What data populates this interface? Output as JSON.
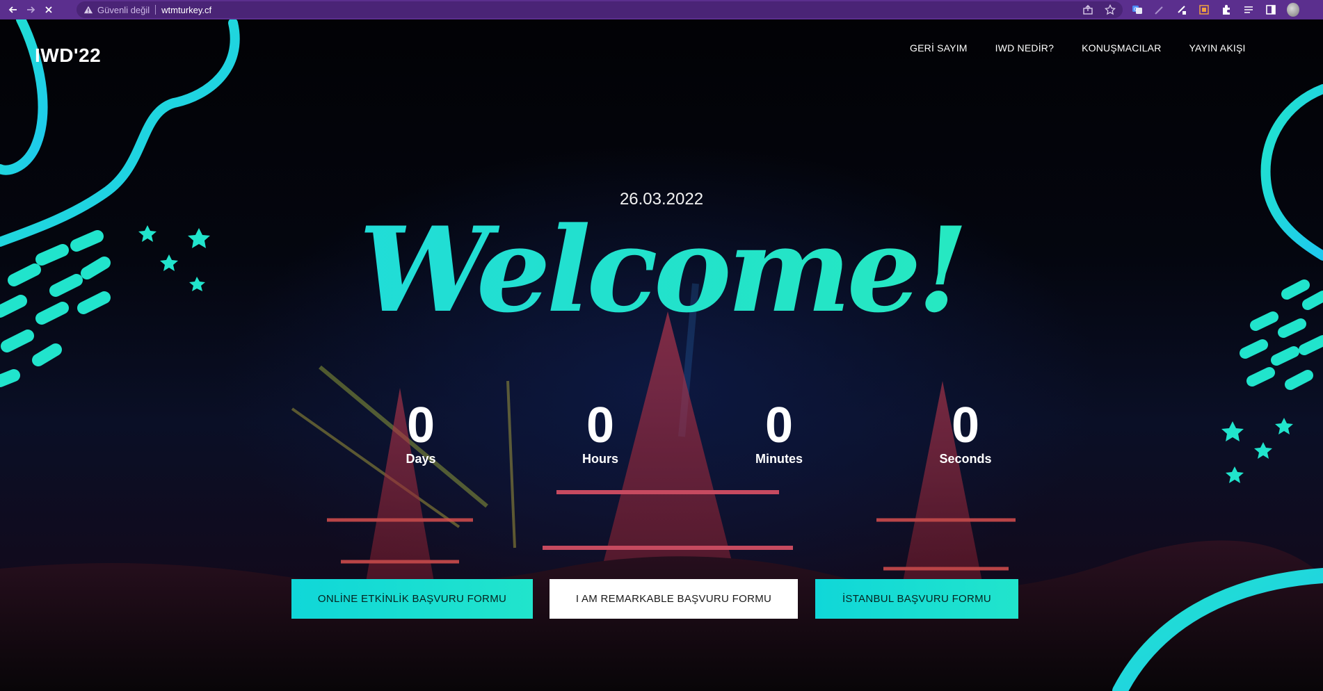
{
  "browser": {
    "security_label": "Güvenli değil",
    "url": "wtmturkey.cf"
  },
  "site": {
    "logo": "IWD'22",
    "nav": [
      "GERİ SAYIM",
      "IWD NEDİR?",
      "KONUŞMACILAR",
      "YAYIN AKIŞI"
    ]
  },
  "hero": {
    "date": "26.03.2022",
    "title": "Welcome!",
    "countdown": [
      {
        "value": "0",
        "label": "Days"
      },
      {
        "value": "0",
        "label": "Hours"
      },
      {
        "value": "0",
        "label": "Minutes"
      },
      {
        "value": "0",
        "label": "Seconds"
      }
    ]
  },
  "buttons": [
    {
      "label": "ONLİNE ETKİNLİK BAŞVURU FORMU",
      "style": "gradient"
    },
    {
      "label": "I AM REMARKABLE BAŞVURU FORMU",
      "style": "white"
    },
    {
      "label": "İSTANBUL BAŞVURU FORMU",
      "style": "gradient"
    }
  ],
  "colors": {
    "browser_bar": "#5b2f8e",
    "accent_teal": "#21e4cc",
    "accent_cyan": "#1ed6e6",
    "background": "#05060c"
  },
  "icons": [
    "back-arrow-icon",
    "forward-arrow-icon",
    "stop-loading-icon",
    "warning-icon",
    "share-icon",
    "bookmark-star-icon",
    "translate-icon",
    "extensions-icon",
    "reading-list-icon",
    "side-panel-icon",
    "profile-avatar-icon"
  ]
}
